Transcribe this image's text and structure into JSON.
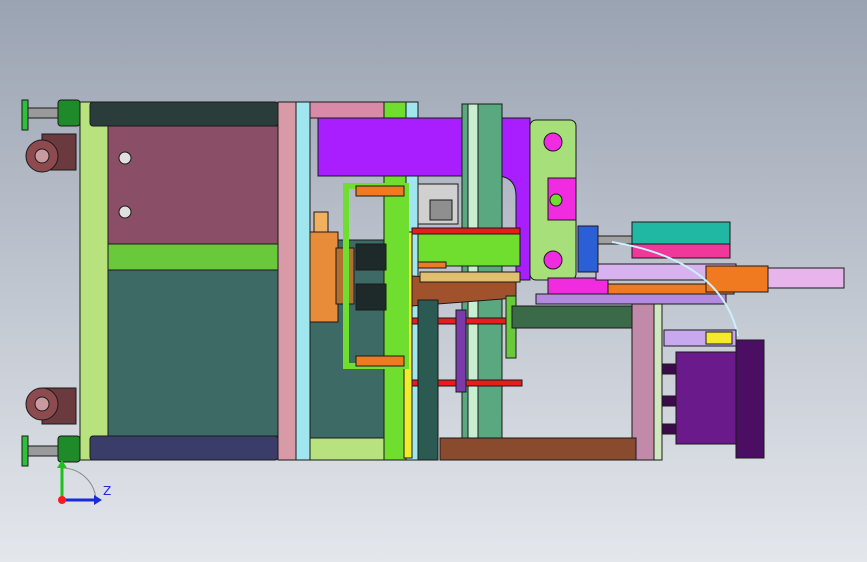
{
  "viewport": {
    "background_top": "#9aa3b2",
    "background_bottom": "#e4e7ec"
  },
  "triad": {
    "axis_label": "Z",
    "colors": {
      "x": "#ff1a1a",
      "y": "#1fbf1f",
      "z": "#1a2bd6"
    }
  },
  "palette": {
    "frame_green": "#b7e27d",
    "frame_dark": "#2a3d3a",
    "panel_wine": "#8a4f66",
    "panel_teal": "#3e6a66",
    "bar_green": "#69c93a",
    "pink_col": "#d99aa8",
    "cyan": "#9fe6ee",
    "lime": "#6fde2f",
    "yellow": "#f2ea2b",
    "violet": "#a81eff",
    "magenta": "#f02be0",
    "orange": "#f07a1f",
    "red": "#e81c1c",
    "brown": "#8a4a2e",
    "teal_box": "#20b7a3",
    "purple_motor": "#6a1a8a",
    "lavender": "#d7b2ee",
    "wheel": "#8e4b4f"
  }
}
